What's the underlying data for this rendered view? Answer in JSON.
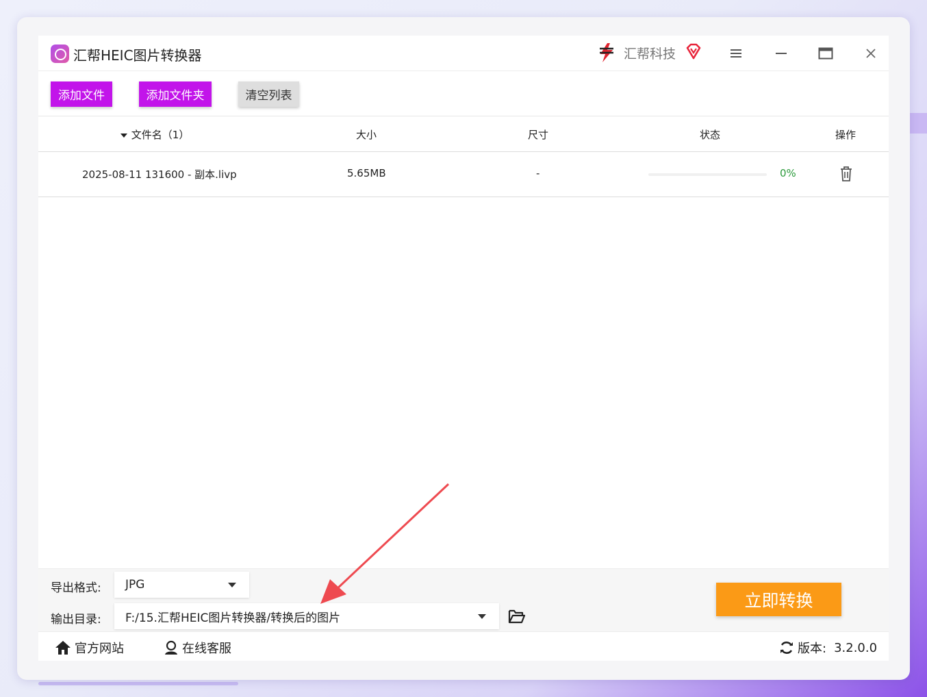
{
  "app": {
    "title": "汇帮HEIC图片转换器",
    "brand": "汇帮科技"
  },
  "toolbar": {
    "add_file": "添加文件",
    "add_folder": "添加文件夹",
    "clear_list": "清空列表"
  },
  "table": {
    "headers": {
      "filename": "文件名（1）",
      "size": "大小",
      "dimension": "尺寸",
      "status": "状态",
      "action": "操作"
    },
    "rows": [
      {
        "filename": "2025-08-11 131600 - 副本.livp",
        "size": "5.65MB",
        "dimension": "-",
        "progress": 0,
        "percent": "0%"
      }
    ]
  },
  "settings": {
    "format_label": "导出格式:",
    "format_value": "JPG",
    "dir_label": "输出目录:",
    "dir_value": "F:/15.汇帮HEIC图片转换器/转换后的图片"
  },
  "convert_button": "立即转换",
  "footer": {
    "website": "官方网站",
    "support": "在线客服",
    "version_label": "版本:",
    "version_value": "3.2.0.0"
  },
  "colors": {
    "accent_purple": "#c214ea",
    "convert_orange": "#fb9a16",
    "progress_pink": "#f8c3d1",
    "percent_green": "#2a9a3a",
    "annotation_arrow": "#ee4a50"
  },
  "icons": [
    "app-logo-icon",
    "brand-logo-icon",
    "vip-diamond-icon",
    "menu-icon",
    "minimize-icon",
    "maximize-icon",
    "close-icon",
    "sort-caret-icon",
    "trash-icon",
    "dropdown-caret-icon",
    "folder-open-icon",
    "home-icon",
    "support-agent-icon",
    "refresh-icon"
  ]
}
